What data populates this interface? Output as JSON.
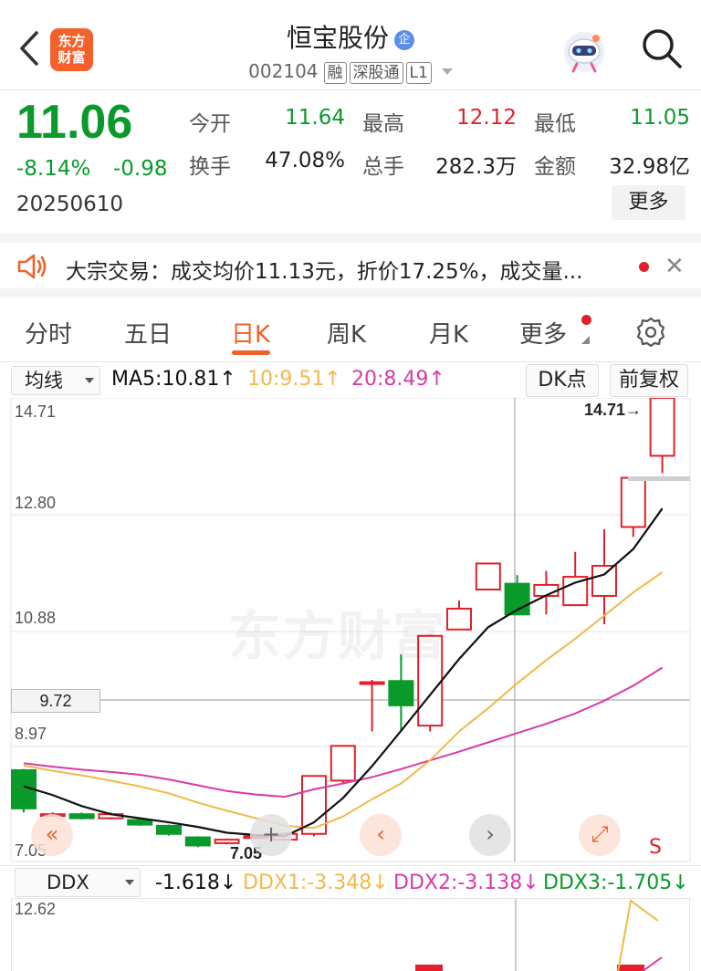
{
  "header": {
    "title": "恒宝股份",
    "badge": "企",
    "code": "002104",
    "tags": [
      "融",
      "深股通",
      "L1"
    ],
    "logo_line1": "东方",
    "logo_line2": "财富"
  },
  "quote": {
    "price": "11.06",
    "change_pct": "-8.14%",
    "change": "-0.98",
    "date": "20250610",
    "open_label": "今开",
    "open": "11.64",
    "high_label": "最高",
    "high": "12.12",
    "low_label": "最低",
    "low": "11.05",
    "turnover_label": "换手",
    "turnover": "47.08%",
    "volume_label": "总手",
    "volume": "282.3万",
    "amount_label": "金额",
    "amount": "32.98亿",
    "more_label": "更多"
  },
  "notice": {
    "text": "大宗交易：成交均价11.13元，折价17.25%，成交量..."
  },
  "tabs": [
    "分时",
    "五日",
    "日K",
    "周K",
    "月K",
    "更多"
  ],
  "active_tab": "日K",
  "indicator_bar": {
    "selector": "均线",
    "ma5": "MA5:10.81↑",
    "ma10": "10:9.51↑",
    "ma20": "20:8.49↑",
    "dk_label": "DK点",
    "adjust_label": "前复权"
  },
  "chart": {
    "y_labels": [
      "14.71",
      "12.80",
      "10.88",
      "8.97",
      "7.05"
    ],
    "crosshair_value": "9.72",
    "max_label": "14.71→",
    "min_label": "7.05",
    "watermark": "东方财富",
    "s_marker": "S",
    "colors": {
      "up": "#e0202b",
      "down": "#0a9a2b",
      "ma5": "#111111",
      "ma10": "#f2b84a",
      "ma20": "#d83aa8"
    }
  },
  "chart_data": {
    "type": "candlestick",
    "ylim": [
      7.05,
      14.71
    ],
    "candles": [
      {
        "o": 8.28,
        "c": 7.62,
        "h": 8.3,
        "l": 7.55
      },
      {
        "o": 7.52,
        "c": 7.52,
        "h": 7.55,
        "l": 7.48
      },
      {
        "o": 7.52,
        "c": 7.45,
        "h": 7.55,
        "l": 7.43
      },
      {
        "o": 7.45,
        "c": 7.52,
        "h": 7.55,
        "l": 7.43
      },
      {
        "o": 7.42,
        "c": 7.34,
        "h": 7.45,
        "l": 7.32
      },
      {
        "o": 7.32,
        "c": 7.18,
        "h": 7.34,
        "l": 7.15
      },
      {
        "o": 7.12,
        "c": 6.98,
        "h": 7.14,
        "l": 6.95
      },
      {
        "o": 7.02,
        "c": 7.08,
        "h": 7.1,
        "l": 7.0
      },
      {
        "o": 7.14,
        "c": 7.14,
        "h": 7.16,
        "l": 7.12
      },
      {
        "o": 7.08,
        "c": 7.18,
        "h": 7.18,
        "l": 7.05
      },
      {
        "o": 7.18,
        "c": 8.18,
        "h": 8.18,
        "l": 7.14
      },
      {
        "o": 8.1,
        "c": 8.7,
        "h": 8.7,
        "l": 8.05
      },
      {
        "o": 9.8,
        "c": 9.8,
        "h": 9.84,
        "l": 8.95
      },
      {
        "o": 9.82,
        "c": 9.4,
        "h": 10.28,
        "l": 8.97
      },
      {
        "o": 9.05,
        "c": 10.6,
        "h": 10.62,
        "l": 8.95
      },
      {
        "o": 10.71,
        "c": 11.07,
        "h": 11.21,
        "l": 10.71
      },
      {
        "o": 11.4,
        "c": 11.85,
        "h": 11.85,
        "l": 11.4
      },
      {
        "o": 11.5,
        "c": 10.97,
        "h": 11.65,
        "l": 10.97
      },
      {
        "o": 11.29,
        "c": 11.48,
        "h": 11.72,
        "l": 10.97
      },
      {
        "o": 11.13,
        "c": 11.62,
        "h": 12.05,
        "l": 11.13
      },
      {
        "o": 11.29,
        "c": 11.81,
        "h": 12.44,
        "l": 10.8
      },
      {
        "o": 12.48,
        "c": 13.33,
        "h": 13.33,
        "l": 12.31
      },
      {
        "o": 13.71,
        "c": 14.71,
        "h": 14.71,
        "l": 13.41
      }
    ],
    "ma5": [
      8.0,
      7.85,
      7.66,
      7.52,
      7.45,
      7.38,
      7.3,
      7.2,
      7.16,
      7.14,
      7.38,
      7.8,
      8.35,
      8.96,
      9.58,
      10.2,
      10.75,
      11.05,
      11.3,
      11.52,
      11.66,
      12.1,
      12.8
    ],
    "ma10": [
      8.36,
      8.27,
      8.19,
      8.1,
      8.0,
      7.88,
      7.72,
      7.58,
      7.45,
      7.32,
      7.28,
      7.48,
      7.78,
      8.05,
      8.45,
      8.95,
      9.35,
      9.78,
      10.18,
      10.55,
      10.95,
      11.35,
      11.7
    ],
    "ma20": [
      8.4,
      8.34,
      8.29,
      8.25,
      8.2,
      8.12,
      8.02,
      7.92,
      7.86,
      7.82,
      7.95,
      8.05,
      8.16,
      8.3,
      8.45,
      8.6,
      8.76,
      8.92,
      9.08,
      9.26,
      9.48,
      9.74,
      10.05
    ]
  },
  "ddx": {
    "selector": "DDX",
    "value": "-1.618↓",
    "ddx1": "DDX1:-3.348↓",
    "ddx2": "DDX2:-3.138↓",
    "ddx3": "DDX3:-1.705↓",
    "y_label": "12.62"
  }
}
